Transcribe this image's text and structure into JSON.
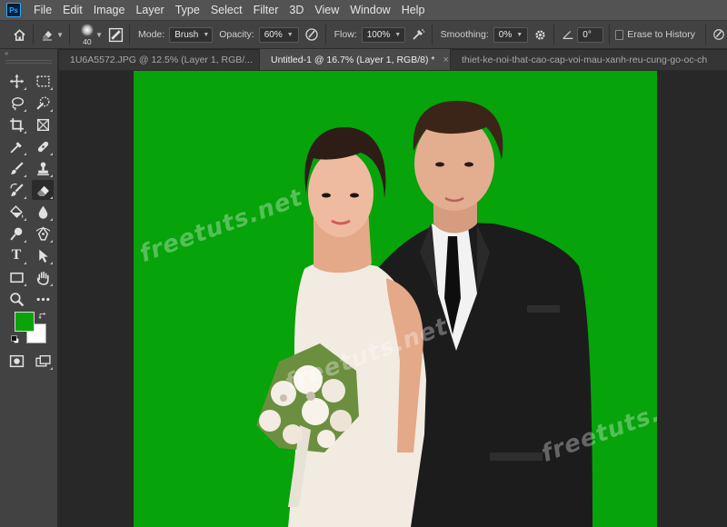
{
  "app": {
    "logo": "Ps"
  },
  "menu": [
    "File",
    "Edit",
    "Image",
    "Layer",
    "Type",
    "Select",
    "Filter",
    "3D",
    "View",
    "Window",
    "Help"
  ],
  "options": {
    "brush_size": "40",
    "mode_label": "Mode:",
    "mode_value": "Brush",
    "opacity_label": "Opacity:",
    "opacity_value": "60%",
    "flow_label": "Flow:",
    "flow_value": "100%",
    "smoothing_label": "Smoothing:",
    "smoothing_value": "0%",
    "angle_value": "0°",
    "erase_history_label": "Erase to History"
  },
  "tabs": [
    {
      "label": "1U6A5572.JPG @ 12.5% (Layer 1, RGB/...",
      "active": false
    },
    {
      "label": "Untitled-1 @ 16.7% (Layer 1, RGB/8) *",
      "active": true
    },
    {
      "label": "thiet-ke-noi-that-cao-cap-voi-mau-xanh-reu-cung-go-oc-ch",
      "active": false
    }
  ],
  "tab_close_glyph": "×",
  "tools": {
    "type_tool_glyph": "T",
    "foreground_color": "#0aa30a",
    "background_color": "#ffffff"
  },
  "canvas": {
    "background_color": "#06a30a",
    "watermarks": [
      "freetuts.net",
      "freetuts.net",
      "freetuts.net"
    ]
  }
}
